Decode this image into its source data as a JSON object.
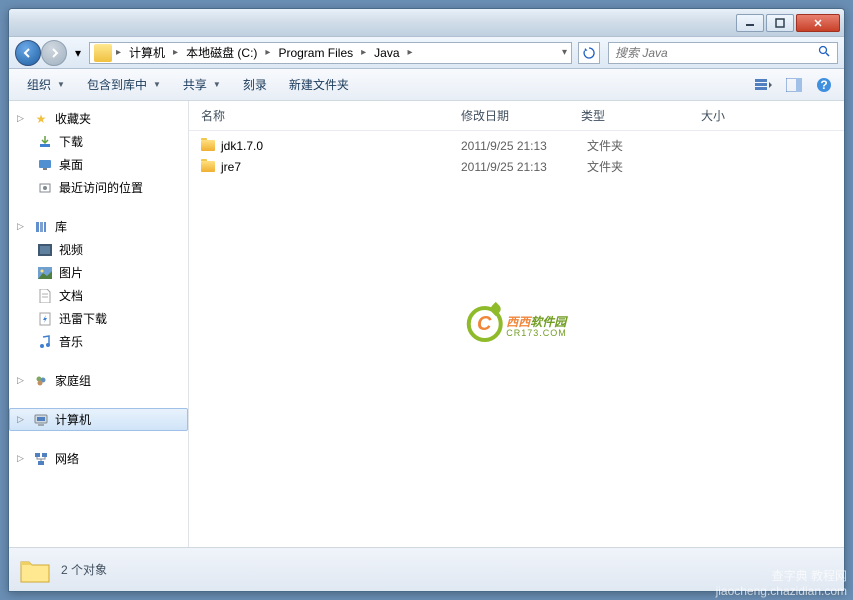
{
  "breadcrumb": [
    "计算机",
    "本地磁盘 (C:)",
    "Program Files",
    "Java"
  ],
  "search_placeholder": "搜索 Java",
  "toolbar": {
    "organize": "组织",
    "include": "包含到库中",
    "share": "共享",
    "burn": "刻录",
    "newfolder": "新建文件夹"
  },
  "sidebar": {
    "favorites": {
      "label": "收藏夹",
      "items": [
        "下载",
        "桌面",
        "最近访问的位置"
      ]
    },
    "libraries": {
      "label": "库",
      "items": [
        "视频",
        "图片",
        "文档",
        "迅雷下载",
        "音乐"
      ]
    },
    "homegroup": "家庭组",
    "computer": "计算机",
    "network": "网络"
  },
  "columns": {
    "name": "名称",
    "date": "修改日期",
    "type": "类型",
    "size": "大小"
  },
  "files": [
    {
      "name": "jdk1.7.0",
      "date": "2011/9/25 21:13",
      "type": "文件夹"
    },
    {
      "name": "jre7",
      "date": "2011/9/25 21:13",
      "type": "文件夹"
    }
  ],
  "status": "2 个对象",
  "watermark": {
    "xixi": "西西",
    "soft": "软件园",
    "url": "CR173.COM"
  },
  "corner": {
    "line1": "查字典 教程网",
    "line2": "jiaocheng.chazidian.com"
  }
}
